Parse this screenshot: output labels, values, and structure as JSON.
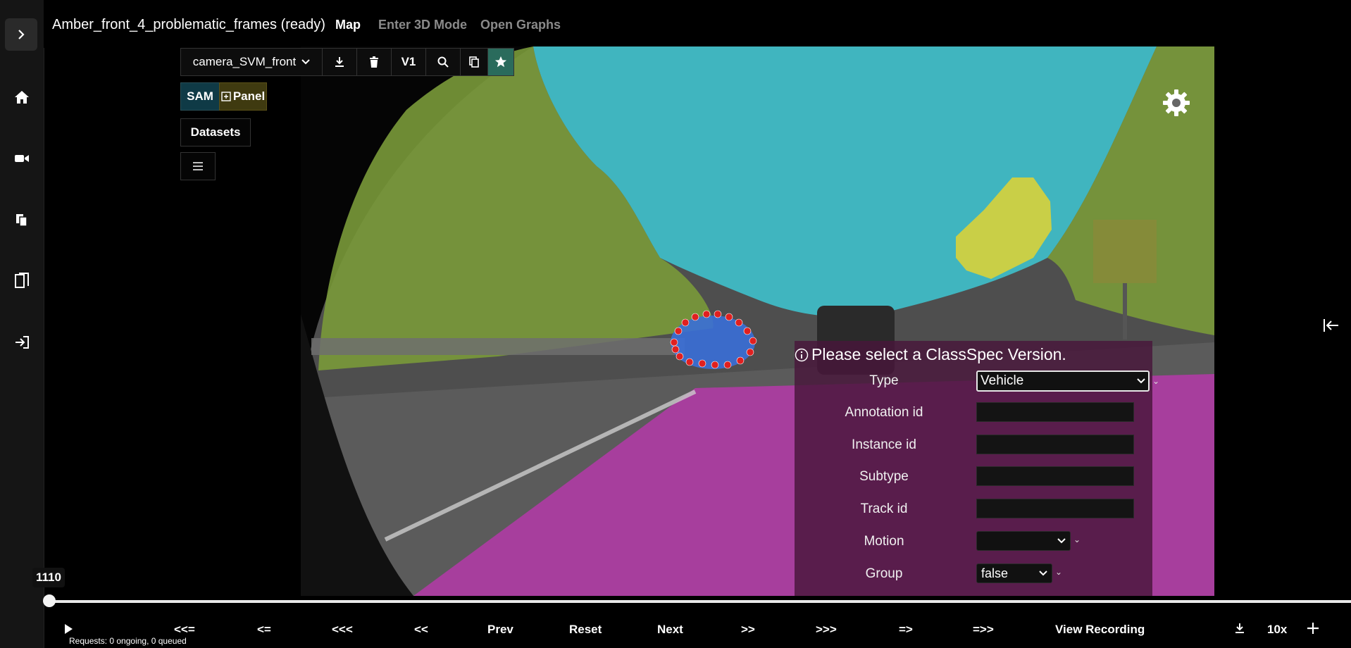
{
  "header": {
    "title": "Amber_front_4_problematic_frames (ready)",
    "tabs": [
      {
        "label": "Map",
        "active": true
      },
      {
        "label": "Enter 3D Mode",
        "active": false
      },
      {
        "label": "Open Graphs",
        "active": false
      }
    ]
  },
  "sidebar": {
    "icons": [
      "chevron-right-icon",
      "home-icon",
      "video-camera-icon",
      "files-icon",
      "document-icon",
      "sign-in-icon"
    ]
  },
  "toolbar": {
    "camera": "camera_SVM_front",
    "version_label": "V1",
    "icons": [
      "download-icon",
      "trash-icon",
      "search-icon",
      "copy-icon",
      "star-icon"
    ]
  },
  "tools": {
    "sam_label": "SAM",
    "panel_label": "Panel",
    "datasets_label": "Datasets"
  },
  "form": {
    "header": "Please select a ClassSpec Version.",
    "fields": [
      {
        "label": "Type",
        "value": "Vehicle"
      },
      {
        "label": "Annotation id",
        "value": ""
      },
      {
        "label": "Instance id",
        "value": ""
      },
      {
        "label": "Subtype",
        "value": ""
      },
      {
        "label": "Track id",
        "value": ""
      },
      {
        "label": "Motion",
        "value": ""
      },
      {
        "label": "Group",
        "value": "false"
      }
    ]
  },
  "playback": {
    "frame": "1110",
    "progress_fraction": 0.0,
    "buttons": [
      "<<=",
      "<=",
      "<<<",
      "<<",
      "Prev",
      "Reset",
      "Next",
      ">>",
      ">>>",
      "=>",
      "=>>",
      "View Recording"
    ],
    "speed": "10x",
    "requests": "Requests: 0 ongoing, 0 queued"
  },
  "colors": {
    "sky_mask": "#3fc1cc",
    "vegetation_mask": "#7a9a3a",
    "road_mask": "#b23aa6",
    "vehicle_mask": "#3a6fd8",
    "building_mask": "#d8d23a",
    "polygon_point": "#e02020",
    "sam_bg": "#0f3a46",
    "panel_bg": "#3f3a10",
    "star_bg": "#2a6b5c"
  }
}
